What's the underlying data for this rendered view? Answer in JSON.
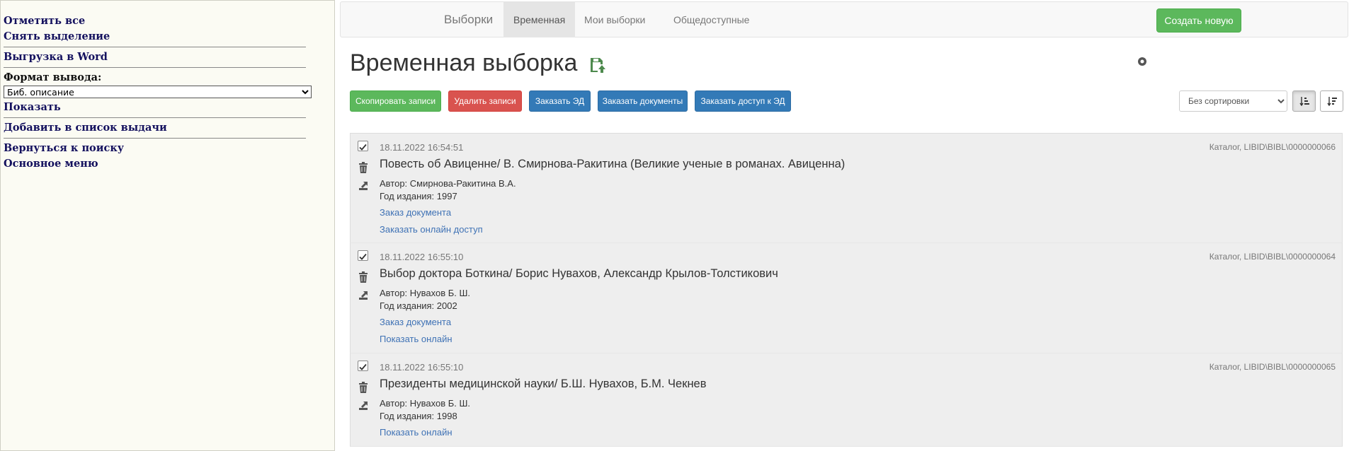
{
  "sidebar": {
    "select_all": "Отметить все",
    "deselect": "Снять выделение",
    "export_word": "Выгрузка в Word",
    "format_label": "Формат вывода:",
    "format_value": "Биб. описание",
    "show": "Показать",
    "add_to_issue_list": "Добавить в список выдачи",
    "back_to_search": "Вернуться к поиску",
    "main_menu": "Основное меню"
  },
  "nav": {
    "brand": "Выборки",
    "tabs": [
      {
        "label": "Временная"
      },
      {
        "label": "Мои выборки"
      },
      {
        "label": "Общедоступные"
      }
    ],
    "create_button": "Создать новую"
  },
  "page": {
    "title": "Временная выборка"
  },
  "actions": {
    "copy": "Скопировать записи",
    "delete": "Удалить записи",
    "order_ed": "Заказать ЭД",
    "order_docs": "Заказать документы",
    "order_access": "Заказать доступ к ЭД"
  },
  "sort": {
    "selected": "Без сортировки"
  },
  "colors": {
    "green": "#5cb85c",
    "red": "#d9534f",
    "blue": "#337ab7",
    "link": "#3f72b5",
    "sidebar_link": "#14115e"
  },
  "records": [
    {
      "date": "18.11.2022 16:54:51",
      "source": "Каталог, LIBID\\BIBL\\0000000066",
      "title": "Повесть об Авиценне/ В. Смирнова-Ракитина (Великие ученые в романах. Авиценна)",
      "author": "Автор: Смирнова-Ракитина В.А.",
      "year": "Год издания: 1997",
      "links": [
        "Заказ документа",
        "Заказать онлайн доступ"
      ]
    },
    {
      "date": "18.11.2022 16:55:10",
      "source": "Каталог, LIBID\\BIBL\\0000000064",
      "title": "Выбор доктора Боткина/ Борис Нувахов, Александр Крылов-Толстикович",
      "author": "Автор: Нувахов Б. Ш.",
      "year": "Год издания: 2002",
      "links": [
        "Заказ документа",
        "Показать онлайн"
      ]
    },
    {
      "date": "18.11.2022 16:55:10",
      "source": "Каталог, LIBID\\BIBL\\0000000065",
      "title": "Президенты медицинской науки/ Б.Ш. Нувахов, Б.М. Чекнев",
      "author": "Автор: Нувахов Б. Ш.",
      "year": "Год издания: 1998",
      "links": [
        "Показать онлайн"
      ]
    }
  ]
}
